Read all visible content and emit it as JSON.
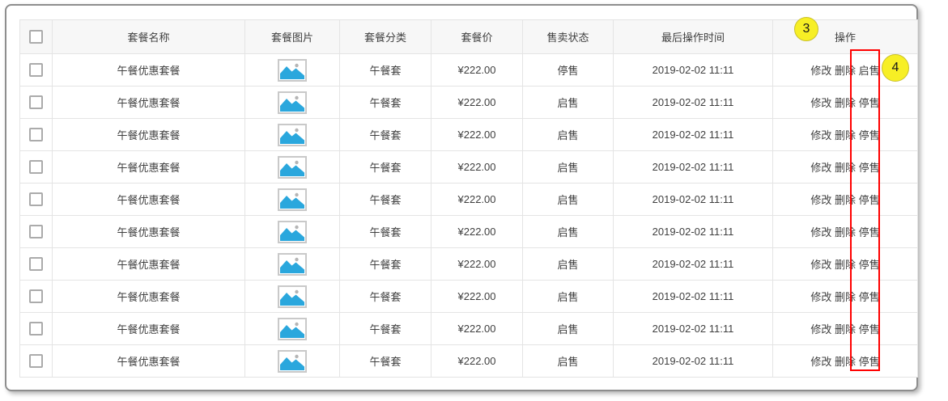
{
  "annotations": {
    "badge_3": "3",
    "badge_4": "4",
    "highlight_color": "#ff0000",
    "badge_color": "#f7ef25"
  },
  "colors": {
    "header_bg": "#f7f7f7",
    "cell_border": "#e4e4e4",
    "panel_border": "#8e8e8e",
    "text": "#3f3f3f",
    "icon_blue": "#2aa7dd"
  },
  "table": {
    "columns": [
      "套餐名称",
      "套餐图片",
      "套餐分类",
      "套餐价",
      "售卖状态",
      "最后操作时间",
      "操作"
    ],
    "image_icon": "image-placeholder-icon",
    "rows": [
      {
        "name": "午餐优惠套餐",
        "category": "午餐套",
        "price": "¥222.00",
        "status": "停售",
        "time": "2019-02-02 11:11",
        "actions": [
          "修改",
          "删除",
          "启售"
        ]
      },
      {
        "name": "午餐优惠套餐",
        "category": "午餐套",
        "price": "¥222.00",
        "status": "启售",
        "time": "2019-02-02 11:11",
        "actions": [
          "修改",
          "删除",
          "停售"
        ]
      },
      {
        "name": "午餐优惠套餐",
        "category": "午餐套",
        "price": "¥222.00",
        "status": "启售",
        "time": "2019-02-02 11:11",
        "actions": [
          "修改",
          "删除",
          "停售"
        ]
      },
      {
        "name": "午餐优惠套餐",
        "category": "午餐套",
        "price": "¥222.00",
        "status": "启售",
        "time": "2019-02-02 11:11",
        "actions": [
          "修改",
          "删除",
          "停售"
        ]
      },
      {
        "name": "午餐优惠套餐",
        "category": "午餐套",
        "price": "¥222.00",
        "status": "启售",
        "time": "2019-02-02 11:11",
        "actions": [
          "修改",
          "删除",
          "停售"
        ]
      },
      {
        "name": "午餐优惠套餐",
        "category": "午餐套",
        "price": "¥222.00",
        "status": "启售",
        "time": "2019-02-02 11:11",
        "actions": [
          "修改",
          "删除",
          "停售"
        ]
      },
      {
        "name": "午餐优惠套餐",
        "category": "午餐套",
        "price": "¥222.00",
        "status": "启售",
        "time": "2019-02-02 11:11",
        "actions": [
          "修改",
          "删除",
          "停售"
        ]
      },
      {
        "name": "午餐优惠套餐",
        "category": "午餐套",
        "price": "¥222.00",
        "status": "启售",
        "time": "2019-02-02 11:11",
        "actions": [
          "修改",
          "删除",
          "停售"
        ]
      },
      {
        "name": "午餐优惠套餐",
        "category": "午餐套",
        "price": "¥222.00",
        "status": "启售",
        "time": "2019-02-02 11:11",
        "actions": [
          "修改",
          "删除",
          "停售"
        ]
      },
      {
        "name": "午餐优惠套餐",
        "category": "午餐套",
        "price": "¥222.00",
        "status": "启售",
        "time": "2019-02-02 11:11",
        "actions": [
          "修改",
          "删除",
          "停售"
        ]
      }
    ]
  }
}
